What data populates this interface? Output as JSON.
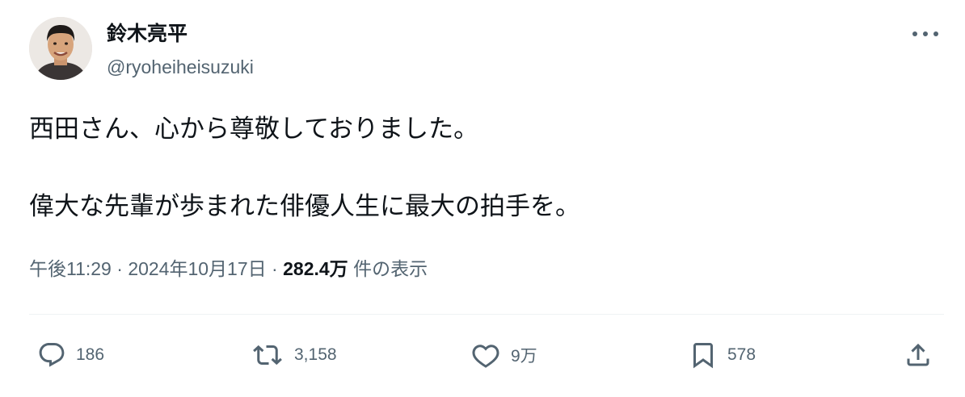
{
  "author": {
    "display_name": "鈴木亮平",
    "handle": "@ryoheiheisuzuki",
    "avatar_icon": "profile-photo"
  },
  "tweet": {
    "lines": [
      "西田さん、心から尊敬しておりました。",
      "偉大な先輩が歩まれた俳優人生に最大の拍手を。"
    ]
  },
  "meta": {
    "time": "午後11:29",
    "separator": "·",
    "date": "2024年10月17日",
    "views_count": "282.4万",
    "views_label": "件の表示"
  },
  "actions": {
    "reply": {
      "icon": "reply-icon",
      "count": "186"
    },
    "retweet": {
      "icon": "retweet-icon",
      "count": "3,158"
    },
    "like": {
      "icon": "heart-icon",
      "count": "9万"
    },
    "bookmark": {
      "icon": "bookmark-icon",
      "count": "578"
    },
    "share": {
      "icon": "share-icon"
    }
  },
  "colors": {
    "text_primary": "#0f1419",
    "text_secondary": "#536471",
    "divider": "#eff3f4"
  }
}
